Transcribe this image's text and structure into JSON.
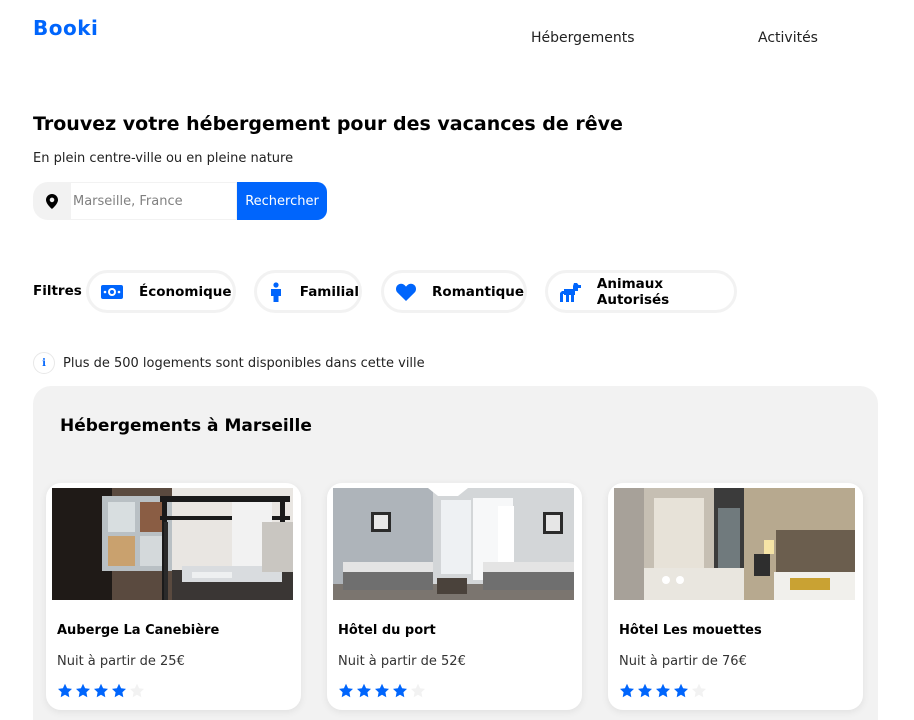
{
  "header": {
    "logo": "Booki",
    "nav": [
      "Hébergements",
      "Activités"
    ]
  },
  "hero": {
    "title": "Trouvez votre hébergement pour des vacances de rêve",
    "subtitle": "En plein centre-ville ou en pleine nature",
    "search_placeholder": "Marseille, France",
    "search_button": "Rechercher"
  },
  "filters": {
    "label": "Filtres",
    "items": [
      {
        "label": "Économique",
        "icon": "money-icon"
      },
      {
        "label": "Familial",
        "icon": "person-icon"
      },
      {
        "label": "Romantique",
        "icon": "heart-icon"
      },
      {
        "label": "Animaux Autorisés",
        "icon": "dog-icon"
      }
    ]
  },
  "info": {
    "text": "Plus de 500 logements sont disponibles dans cette ville",
    "icon": "info-icon"
  },
  "listing": {
    "title": "Hébergements à Marseille",
    "cards": [
      {
        "name": "Auberge La Canebière",
        "price": "Nuit à partir de 25€",
        "rating": 4
      },
      {
        "name": "Hôtel du port",
        "price": "Nuit à partir de 52€",
        "rating": 4
      },
      {
        "name": "Hôtel Les mouettes",
        "price": "Nuit à partir de 76€",
        "rating": 4
      }
    ]
  },
  "colors": {
    "accent": "#0065FC",
    "panel": "#F2F2F2",
    "star_off": "#F2F2F2"
  }
}
